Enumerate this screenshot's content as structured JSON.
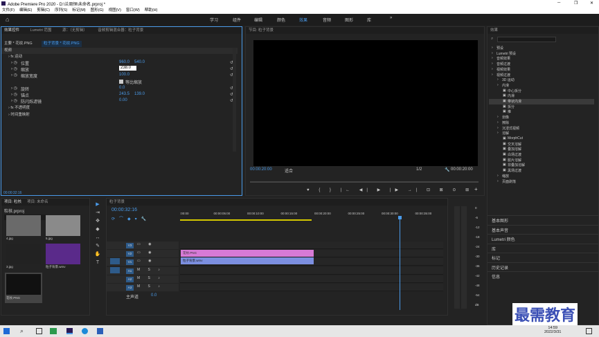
{
  "title": "Adobe Premiere Pro 2020 - D:\\兰周恒\\未命名.prproj *",
  "menu": [
    "文件(F)",
    "编辑(E)",
    "剪辑(C)",
    "序列(S)",
    "标记(M)",
    "图形(G)",
    "视图(V)",
    "窗口(W)",
    "帮助(H)"
  ],
  "workspaces": [
    "学习",
    "组件",
    "编辑",
    "颜色",
    "效果",
    "音频",
    "图形",
    "库"
  ],
  "ws_more": "»",
  "effect_controls": {
    "tabs": [
      "效果控件",
      "Lumetri 范围",
      "源：（无剪辑）",
      "音频剪辑混合器：粒子背景"
    ],
    "source": "主要 * 花纹.PNG",
    "clip": "粒子背景 * 花纹.PNG",
    "section": "视频",
    "motion": "运动",
    "props": [
      {
        "name": "位置",
        "v1": "960.0",
        "v2": "540.0"
      },
      {
        "name": "缩放",
        "v1": "238.0",
        "v2": ""
      },
      {
        "name": "缩放宽度",
        "v1": "100.0",
        "v2": ""
      },
      {
        "name": "等比缩放",
        "v1": "",
        "v2": ""
      },
      {
        "name": "旋转",
        "v1": "0.0",
        "v2": ""
      },
      {
        "name": "锚点",
        "v1": "243.5",
        "v2": "139.0"
      },
      {
        "name": "防闪烁滤镜",
        "v1": "0.00",
        "v2": ""
      }
    ],
    "opacity": "不透明度",
    "remap": "时间重映射",
    "time": "00:00:32:16"
  },
  "program": {
    "title": "节目: 粒子背景",
    "tc_left": "00:00:20:00",
    "fit": "适合",
    "quality": "1/2",
    "tc_right": "00:00:20:00"
  },
  "effects": {
    "title": "效果",
    "tree": [
      {
        "t": "预设",
        "l": 0
      },
      {
        "t": "Lumetri 预设",
        "l": 0
      },
      {
        "t": "音频效果",
        "l": 0
      },
      {
        "t": "音频过渡",
        "l": 0
      },
      {
        "t": "视频效果",
        "l": 0
      },
      {
        "t": "视频过渡",
        "l": 0
      },
      {
        "t": "3D 运动",
        "l": 1
      },
      {
        "t": "内滑",
        "l": 1
      },
      {
        "t": "中心拆分",
        "l": 2
      },
      {
        "t": "内滑",
        "l": 2
      },
      {
        "t": "带状内滑",
        "l": 2
      },
      {
        "t": "拆分",
        "l": 2
      },
      {
        "t": "推",
        "l": 2
      },
      {
        "t": "划像",
        "l": 1
      },
      {
        "t": "擦除",
        "l": 1
      },
      {
        "t": "沉浸式视频",
        "l": 1
      },
      {
        "t": "溶解",
        "l": 1
      },
      {
        "t": "MorphCut",
        "l": 2
      },
      {
        "t": "交叉溶解",
        "l": 2
      },
      {
        "t": "叠加溶解",
        "l": 2
      },
      {
        "t": "白场过渡",
        "l": 2
      },
      {
        "t": "胶片溶解",
        "l": 2
      },
      {
        "t": "非叠加溶解",
        "l": 2
      },
      {
        "t": "黑场过渡",
        "l": 2
      },
      {
        "t": "缩放",
        "l": 1
      },
      {
        "t": "页面剥落",
        "l": 1
      }
    ],
    "others": [
      "基本图形",
      "基本声音",
      "Lumetri 颜色",
      "库",
      "标记",
      "历史记录",
      "信息"
    ]
  },
  "project": {
    "tabs": [
      "项目: 粒核",
      "项目: 未命名"
    ],
    "name": "粒核.prproj",
    "items": [
      {
        "label": "4.jpg"
      },
      {
        "label": "5.jpg"
      },
      {
        "label": "3.jpg"
      },
      {
        "label": "粒子背景.wmv"
      },
      {
        "label": "花纹.PNG"
      }
    ]
  },
  "timeline": {
    "title": "粒子背景",
    "tc": "00:00:32:16",
    "ruler": [
      ":00:00",
      "00:00:05:00",
      "00:00:10:00",
      "00:00:15:00",
      "00:00:20:00",
      "00:00:25:00",
      "00:00:30:00",
      "00:00:35:00"
    ],
    "tracks": [
      "V3",
      "V2",
      "V1",
      "A1",
      "A2",
      "A3"
    ],
    "master": "主声道",
    "master_val": "0.0",
    "clips": [
      {
        "label": "花纹.PNG"
      },
      {
        "label": "粒子背景.wmv"
      }
    ]
  },
  "meter": [
    "0",
    "-6",
    "-12",
    "-18",
    "-24",
    "-30",
    "-36",
    "-42",
    "-48",
    "-54",
    "dB"
  ],
  "watermark": "最需教育",
  "clock": {
    "time": "14:59",
    "date": "2022/3/31"
  },
  "colors": {
    "accent": "#4a9bea",
    "pink": "#d76fd6",
    "blue": "#6e88d8"
  }
}
